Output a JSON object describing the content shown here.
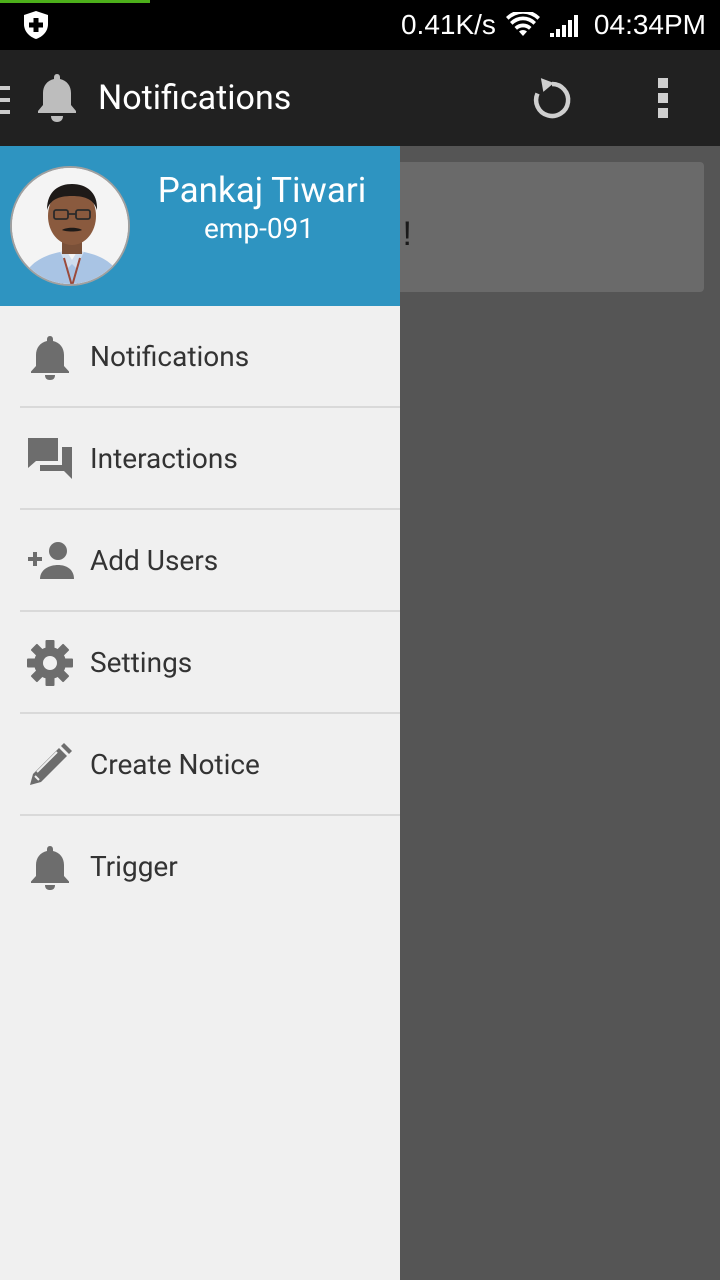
{
  "status_bar": {
    "speed": "0.41K/s",
    "time": "04:34PM"
  },
  "app_bar": {
    "title": "Notifications",
    "bell_icon": "bell-icon",
    "refresh_icon": "refresh-icon",
    "overflow_icon": "more-vert-icon"
  },
  "background": {
    "empty_text": "ound !!"
  },
  "drawer": {
    "user_name": "Pankaj Tiwari",
    "user_id": "emp-091",
    "items": [
      {
        "label": "Notifications",
        "icon": "bell-icon"
      },
      {
        "label": "Interactions",
        "icon": "chat-icon"
      },
      {
        "label": "Add Users",
        "icon": "add-user-icon"
      },
      {
        "label": "Settings",
        "icon": "gear-icon"
      },
      {
        "label": "Create Notice",
        "icon": "pencil-icon"
      },
      {
        "label": "Trigger",
        "icon": "bell-icon"
      }
    ]
  },
  "colors": {
    "drawer_header": "#2e94c1",
    "app_bar": "#212121",
    "icon_gray": "#6d6d6d"
  }
}
